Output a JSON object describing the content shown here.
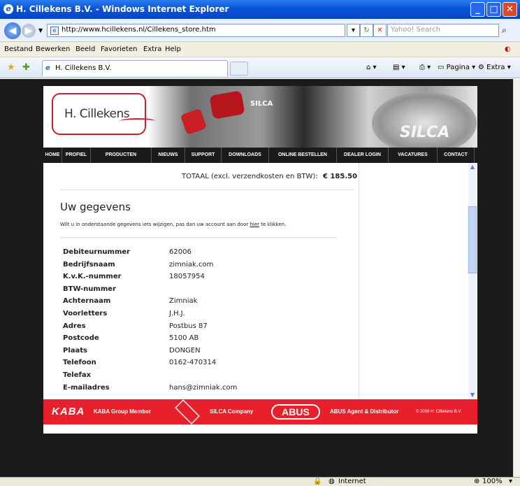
{
  "window": {
    "title": "H. Cillekens B.V. - Windows Internet Explorer"
  },
  "address": {
    "url": "http://www.hcillekens.nl/Cillekens_store.htm",
    "search_placeholder": "Yahoo! Search"
  },
  "menu": [
    "Bestand",
    "Bewerken",
    "Beeld",
    "Favorieten",
    "Extra",
    "Help"
  ],
  "tab": {
    "label": "H. Cillekens B.V."
  },
  "toolbar": {
    "page_label": "Pagina",
    "extra_label": "Extra"
  },
  "site": {
    "logo_text": "H. Cillekens",
    "banner_silca": "SILCA",
    "banner_disc": "SILCA",
    "nav": [
      "HOME",
      "PROFIEL",
      "PRODUCTEN",
      "NIEUWS",
      "SUPPORT",
      "DOWNLOADS",
      "ONLINE BESTELLEN",
      "DEALER LOGIN",
      "VACATURES",
      "CONTACT"
    ],
    "total_label": "TOTAAL (excl. verzendkosten en BTW):",
    "total_value": "€ 185.50",
    "heading": "Uw gegevens",
    "info_before": "Wilt u in onderstaande gegevens iets wijzigen, pas dan uw account aan door ",
    "info_link": "hier",
    "info_after": " te klikken.",
    "fields": [
      {
        "label": "Debiteurnummer",
        "value": "62006"
      },
      {
        "label": "Bedrijfsnaam",
        "value": "zimniak.com"
      },
      {
        "label": "K.v.K.-nummer",
        "value": "18057954"
      },
      {
        "label": "BTW-nummer",
        "value": ""
      },
      {
        "label": "Achternaam",
        "value": "Zimniak"
      },
      {
        "label": "Voorletters",
        "value": "J.H.J."
      },
      {
        "label": "Adres",
        "value": "Postbus 87"
      },
      {
        "label": "Postcode",
        "value": "5100 AB"
      },
      {
        "label": "Plaats",
        "value": "DONGEN"
      },
      {
        "label": "Telefoon",
        "value": "0162-470314"
      },
      {
        "label": "Telefax",
        "value": ""
      },
      {
        "label": "E-mailadres",
        "value": "hans@zimniak.com"
      }
    ],
    "footer": {
      "kaba": "KABA",
      "kaba_text": "KABA Group Member",
      "silca_text": "SILCA Company",
      "abus": "ABUS",
      "abus_text": "ABUS Agent & Distributor",
      "copyright": "© 2008 H. Cillekens B.V."
    }
  },
  "status": {
    "zone": "Internet",
    "zoom": "100%"
  }
}
